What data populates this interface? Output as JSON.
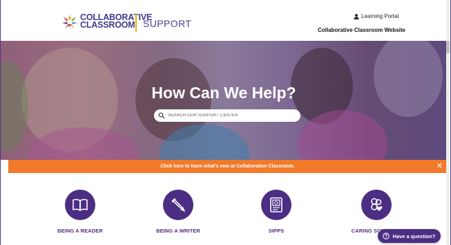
{
  "header": {
    "logo_line1": "COLLABORATIVE",
    "logo_line2": "CLASSROOM",
    "support_label": "SUPPORT",
    "portal_link": "Learning Portal",
    "website_link": "Collaborative Classroom Website"
  },
  "hero": {
    "title": "How Can We Help?",
    "search_placeholder": "SEARCH OUR SUPPORT CENTER"
  },
  "announcement": {
    "text": "Click here to learn what's new at Collaborative Classroom.",
    "close_glyph": "✕"
  },
  "categories": [
    {
      "label": "BEING A READER",
      "icon": "book-icon"
    },
    {
      "label": "BEING A WRITER",
      "icon": "pencil-icon"
    },
    {
      "label": "SIPPS",
      "icon": "workbook-icon"
    },
    {
      "label": "CARING SCHOOL C",
      "icon": "community-heart-icon"
    }
  ],
  "help_button": {
    "label": "Have a question?"
  },
  "colors": {
    "brand_purple": "#4b2e83",
    "accent_orange": "#f27a2b",
    "divider_gold": "#e8b400"
  }
}
